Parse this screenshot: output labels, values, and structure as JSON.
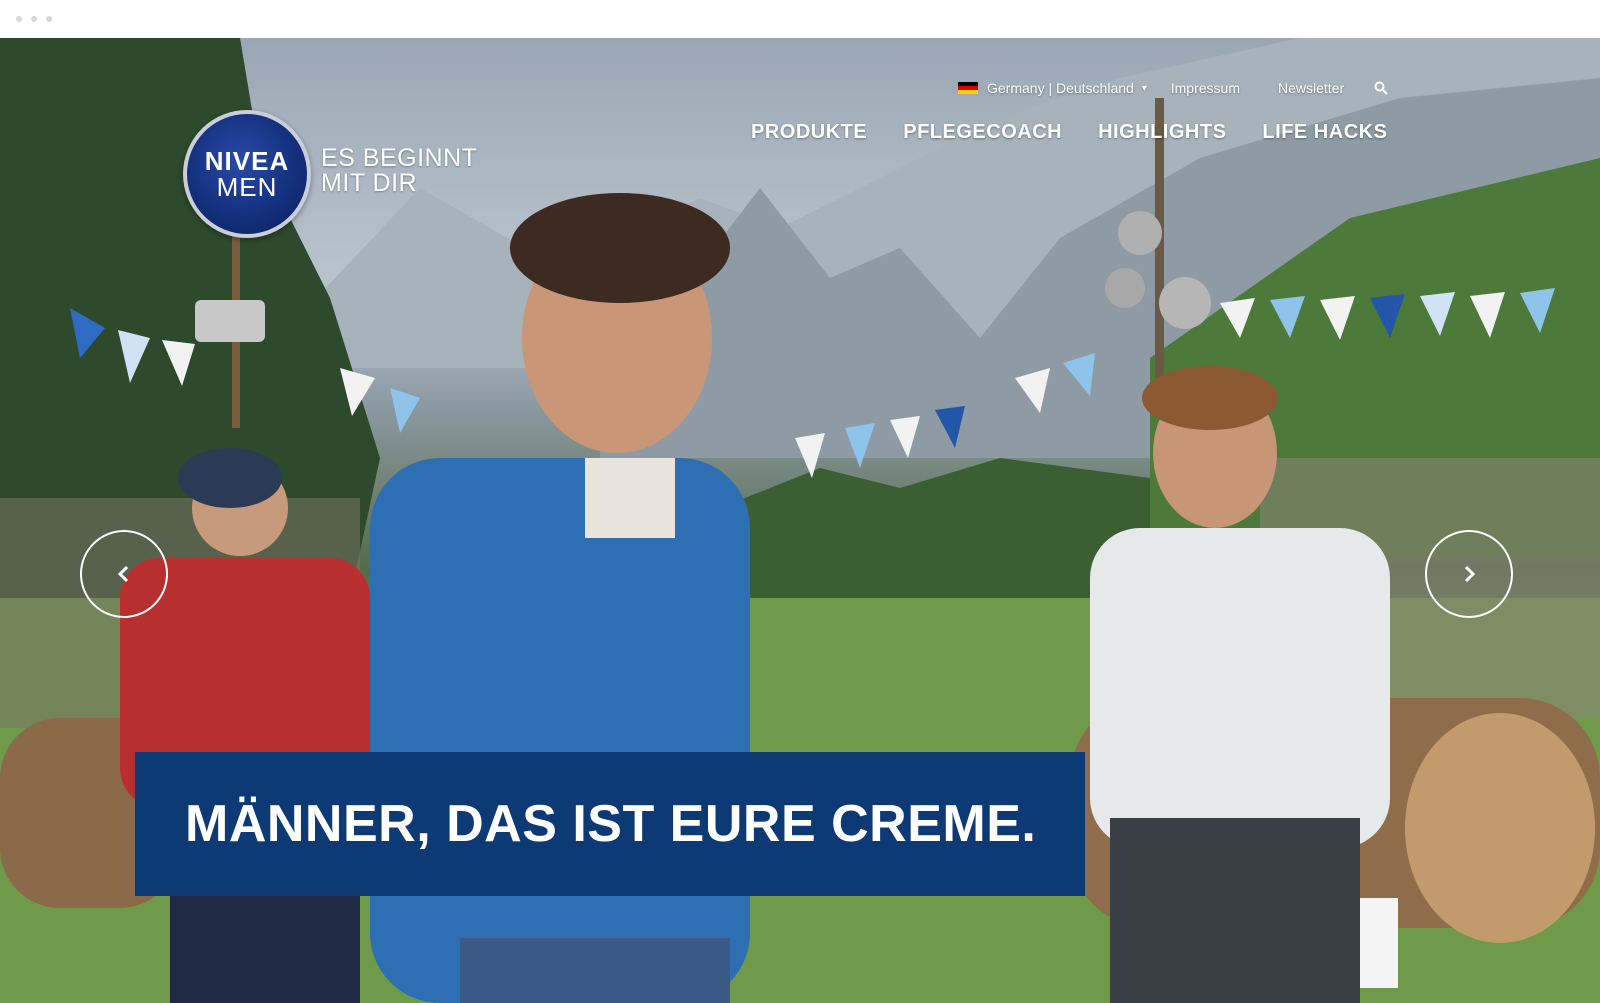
{
  "brand": {
    "logo_line1": "NIVEA",
    "logo_line2": "MEN",
    "tagline_line1": "ES BEGINNT",
    "tagline_line2": "MIT DIR",
    "primary_color": "#0d3a75"
  },
  "utility_nav": {
    "country_label": "Germany | Deutschland",
    "flag_icon": "germany-flag-icon",
    "impressum_label": "Impressum",
    "newsletter_label": "Newsletter",
    "search_icon": "search-icon"
  },
  "main_nav": {
    "items": [
      {
        "label": "PRODUKTE"
      },
      {
        "label": "PFLEGECOACH"
      },
      {
        "label": "HIGHLIGHTS"
      },
      {
        "label": "LIFE HACKS"
      }
    ]
  },
  "carousel": {
    "prev_icon": "chevron-left-icon",
    "next_icon": "chevron-right-icon"
  },
  "hero": {
    "headline": "MÄNNER, DAS IST EURE CREME."
  }
}
